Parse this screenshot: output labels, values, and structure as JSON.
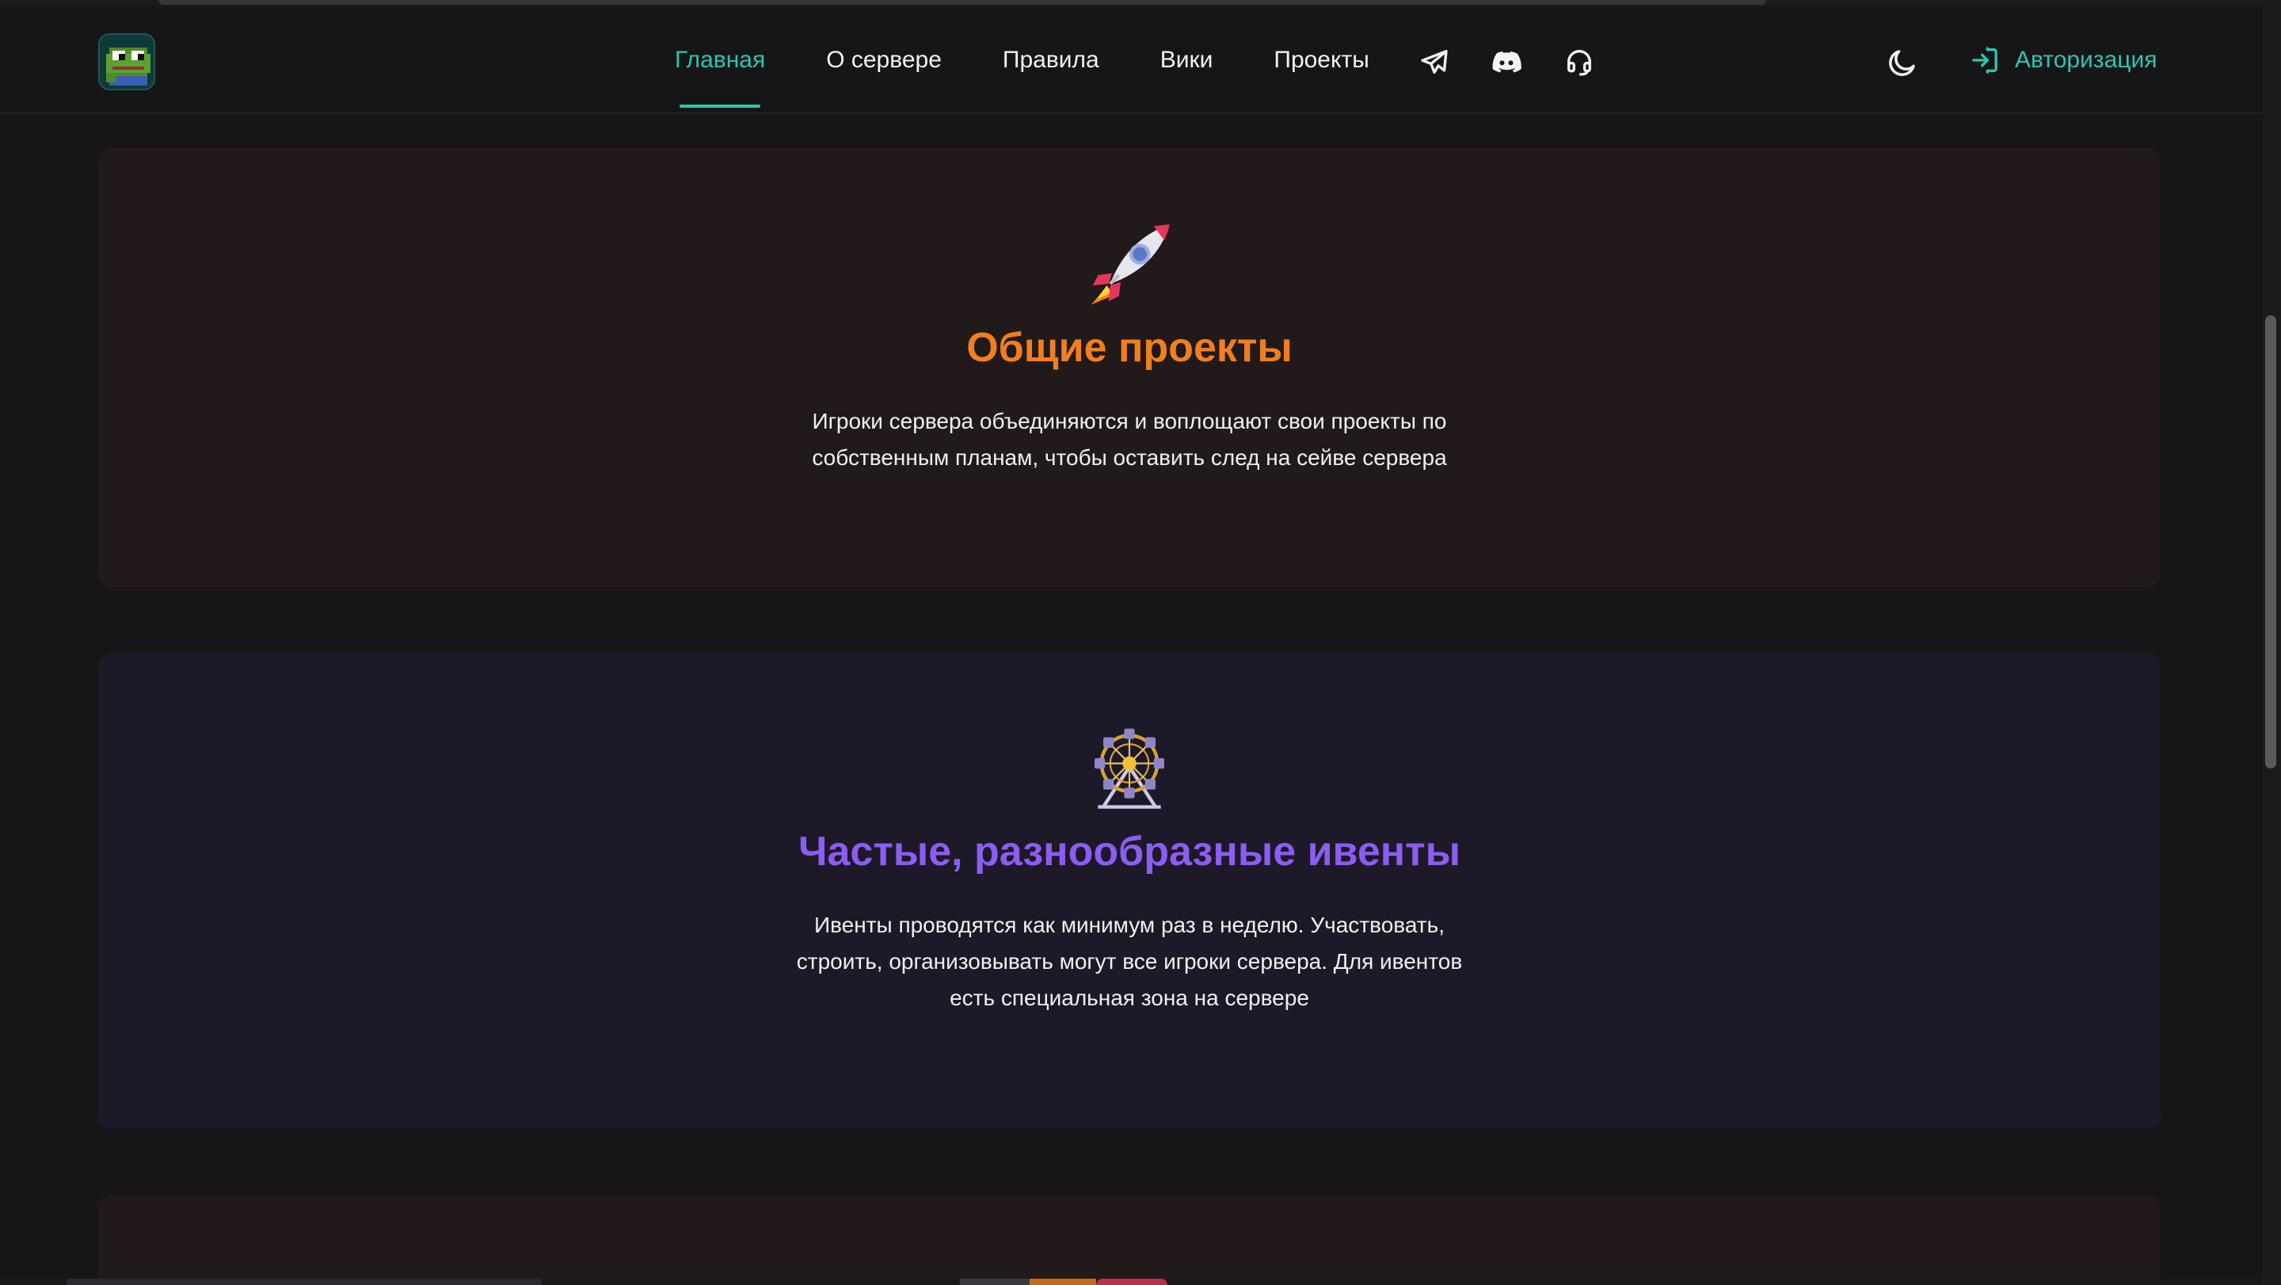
{
  "header": {
    "logo_name": "pixel-frog-logo",
    "nav": [
      {
        "label": "Главная",
        "active": true
      },
      {
        "label": "О сервере",
        "active": false
      },
      {
        "label": "Правила",
        "active": false
      },
      {
        "label": "Вики",
        "active": false
      },
      {
        "label": "Проекты",
        "active": false
      }
    ],
    "social_icons": [
      "telegram-icon",
      "discord-icon",
      "headset-icon"
    ],
    "theme_icon": "moon-icon",
    "auth_label": "Авторизация"
  },
  "features": [
    {
      "icon": "rocket-icon",
      "title": "Общие проекты",
      "text": "Игроки сервера объединяются и воплощают свои проекты по собственным планам, чтобы оставить след на сейве сервера"
    },
    {
      "icon": "ferris-wheel-icon",
      "title": "Частые, разнообразные ивенты",
      "text": "Ивенты проводятся как минимум раз в неделю. Участвовать, строить, организовывать могут все игроки сервера. Для ивентов есть специальная зона на сервере"
    }
  ],
  "colors": {
    "accent": "#2ec4b0",
    "background": "#161618",
    "title_orange": "#f07f1f",
    "title_purple": "#8d5cf0",
    "card_warm": "#221a1a",
    "card_cool": "#1c1a28"
  }
}
